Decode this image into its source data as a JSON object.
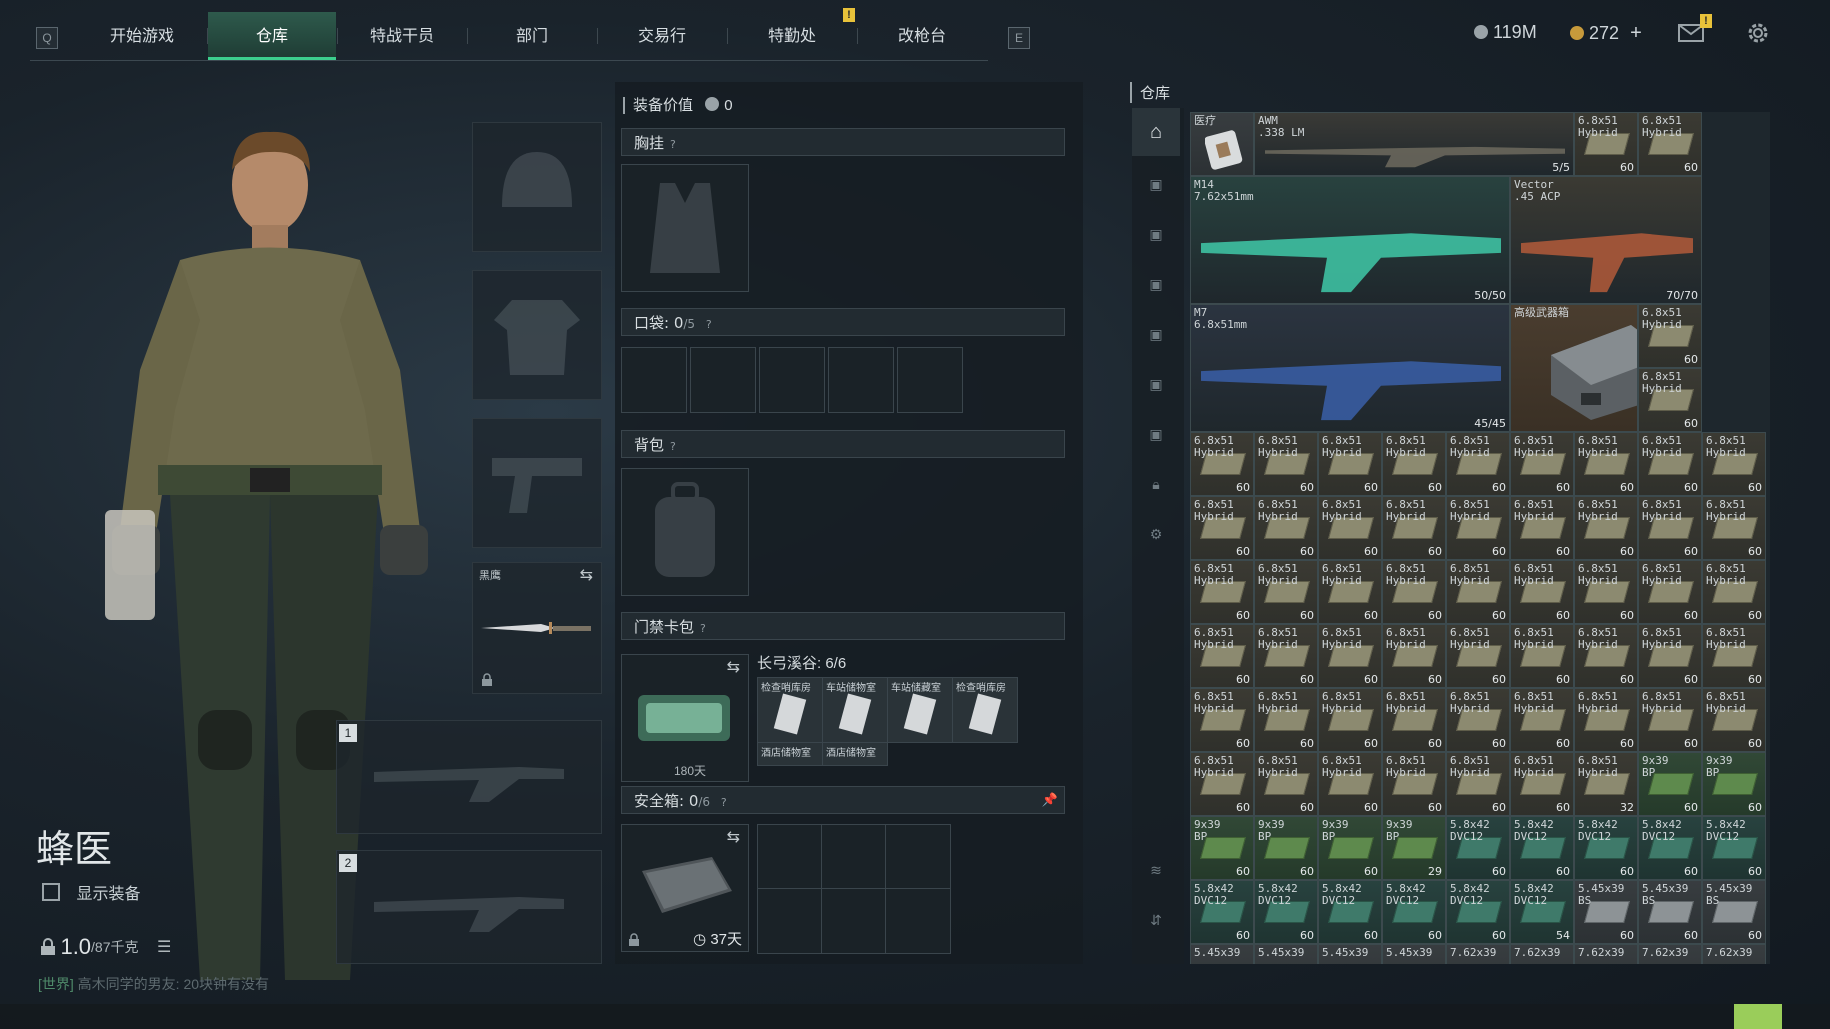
{
  "nav": {
    "left_key": "Q",
    "right_key": "E",
    "tabs": [
      {
        "label": "开始游戏",
        "active": false
      },
      {
        "label": "仓库",
        "active": true
      },
      {
        "label": "特战干员",
        "active": false
      },
      {
        "label": "部门",
        "active": false
      },
      {
        "label": "交易行",
        "active": false
      },
      {
        "label": "特勤处",
        "active": false
      },
      {
        "label": "改枪台",
        "active": false
      }
    ],
    "notif_mark": "!"
  },
  "currency": {
    "coins": "119M",
    "premium": "272",
    "premium_add": "+"
  },
  "character": {
    "name": "蜂医",
    "show_equipment_label": "显示装备",
    "weight": "1.0",
    "weight_max": "/87千克",
    "chat_channel": "[世界]",
    "chat_text": "高木同学的男友: 20块钟有没有",
    "knife_label": "黑鹰",
    "weapon_slot_1": "1",
    "weapon_slot_2": "2"
  },
  "equipment": {
    "value_label": "装备价值",
    "value": "0",
    "chest_rig": "胸挂",
    "pockets_label": "口袋:",
    "pockets_value": "0",
    "pockets_max": "/5",
    "backpack": "背包",
    "keycard_case": "门禁卡包",
    "keycard_map": "长弓溪谷: 6/6",
    "keycards": [
      "检查哨库房",
      "车站储物室",
      "车站储藏室",
      "检查哨库房",
      "酒店储物室",
      "酒店储物室"
    ],
    "keycard_days": "180天",
    "secure_label": "安全箱:",
    "secure_value": "0",
    "secure_max": "/6",
    "secure_days": "37天",
    "help": "?"
  },
  "warehouse": {
    "title": "仓库",
    "weapons": [
      {
        "name": "AWM\n.338 LM",
        "count": "5/5",
        "variant": "sniper"
      },
      {
        "name": "M14\n7.62x51mm",
        "count": "50/50",
        "variant": "teal"
      },
      {
        "name": "Vector\n.45 ACP",
        "count": "70/70",
        "variant": "flag"
      },
      {
        "name": "M7\n6.8x51mm",
        "count": "45/45",
        "variant": "blue"
      }
    ],
    "medkit_label": "医疗",
    "case_label": "高级武器箱",
    "ammo_rows": [
      [
        [
          "6.8x51\nHybrid",
          "60",
          "tan"
        ],
        [
          "6.8x51\nHybrid",
          "60",
          "tan"
        ]
      ],
      [
        [
          "6.8x51\nHybrid",
          "60",
          "tan"
        ],
        [
          "6.8x51\nHybrid",
          "60",
          "tan"
        ],
        [
          "6.8x51\nHybrid",
          "60",
          "tan"
        ],
        [
          "6.8x51\nHybrid",
          "60",
          "tan"
        ],
        [
          "6.8x51\nHybrid",
          "60",
          "tan"
        ],
        [
          "6.8x51\nHybrid",
          "60",
          "tan"
        ],
        [
          "6.8x51\nHybrid",
          "60",
          "tan"
        ],
        [
          "6.8x51\nHybrid",
          "60",
          "tan"
        ],
        [
          "6.8x51\nHybrid",
          "60",
          "tan"
        ]
      ],
      [
        [
          "6.8x51\nHybrid",
          "60",
          "tan"
        ],
        [
          "6.8x51\nHybrid",
          "60",
          "tan"
        ],
        [
          "6.8x51\nHybrid",
          "60",
          "tan"
        ],
        [
          "6.8x51\nHybrid",
          "60",
          "tan"
        ],
        [
          "6.8x51\nHybrid",
          "60",
          "tan"
        ],
        [
          "6.8x51\nHybrid",
          "60",
          "tan"
        ],
        [
          "6.8x51\nHybrid",
          "60",
          "tan"
        ],
        [
          "6.8x51\nHybrid",
          "60",
          "tan"
        ],
        [
          "6.8x51\nHybrid",
          "60",
          "tan"
        ]
      ],
      [
        [
          "6.8x51\nHybrid",
          "60",
          "tan"
        ],
        [
          "6.8x51\nHybrid",
          "60",
          "tan"
        ],
        [
          "6.8x51\nHybrid",
          "60",
          "tan"
        ],
        [
          "6.8x51\nHybrid",
          "60",
          "tan"
        ],
        [
          "6.8x51\nHybrid",
          "60",
          "tan"
        ],
        [
          "6.8x51\nHybrid",
          "60",
          "tan"
        ],
        [
          "6.8x51\nHybrid",
          "60",
          "tan"
        ],
        [
          "6.8x51\nHybrid",
          "60",
          "tan"
        ],
        [
          "6.8x51\nHybrid",
          "60",
          "tan"
        ]
      ],
      [
        [
          "6.8x51\nHybrid",
          "60",
          "tan"
        ],
        [
          "6.8x51\nHybrid",
          "60",
          "tan"
        ],
        [
          "6.8x51\nHybrid",
          "60",
          "tan"
        ],
        [
          "6.8x51\nHybrid",
          "60",
          "tan"
        ],
        [
          "6.8x51\nHybrid",
          "60",
          "tan"
        ],
        [
          "6.8x51\nHybrid",
          "60",
          "tan"
        ],
        [
          "6.8x51\nHybrid",
          "60",
          "tan"
        ],
        [
          "6.8x51\nHybrid",
          "60",
          "tan"
        ],
        [
          "6.8x51\nHybrid",
          "60",
          "tan"
        ]
      ],
      [
        [
          "6.8x51\nHybrid",
          "60",
          "tan"
        ],
        [
          "6.8x51\nHybrid",
          "60",
          "tan"
        ],
        [
          "6.8x51\nHybrid",
          "60",
          "tan"
        ],
        [
          "6.8x51\nHybrid",
          "60",
          "tan"
        ],
        [
          "6.8x51\nHybrid",
          "60",
          "tan"
        ],
        [
          "6.8x51\nHybrid",
          "60",
          "tan"
        ],
        [
          "6.8x51\nHybrid",
          "60",
          "tan"
        ],
        [
          "6.8x51\nHybrid",
          "60",
          "tan"
        ],
        [
          "6.8x51\nHybrid",
          "60",
          "tan"
        ]
      ],
      [
        [
          "6.8x51\nHybrid",
          "60",
          "tan"
        ],
        [
          "6.8x51\nHybrid",
          "60",
          "tan"
        ],
        [
          "6.8x51\nHybrid",
          "60",
          "tan"
        ],
        [
          "6.8x51\nHybrid",
          "60",
          "tan"
        ],
        [
          "6.8x51\nHybrid",
          "60",
          "tan"
        ],
        [
          "6.8x51\nHybrid",
          "60",
          "tan"
        ],
        [
          "6.8x51\nHybrid",
          "32",
          "tan"
        ],
        [
          "9x39\nBP",
          "60",
          "green"
        ],
        [
          "9x39\nBP",
          "60",
          "green"
        ]
      ],
      [
        [
          "9x39\nBP",
          "60",
          "green"
        ],
        [
          "9x39\nBP",
          "60",
          "green"
        ],
        [
          "9x39\nBP",
          "60",
          "green"
        ],
        [
          "9x39\nBP",
          "29",
          "green"
        ],
        [
          "5.8x42\nDVC12",
          "60",
          "teal"
        ],
        [
          "5.8x42\nDVC12",
          "60",
          "teal"
        ],
        [
          "5.8x42\nDVC12",
          "60",
          "teal"
        ],
        [
          "5.8x42\nDVC12",
          "60",
          "teal"
        ],
        [
          "5.8x42\nDVC12",
          "60",
          "teal"
        ]
      ],
      [
        [
          "5.8x42\nDVC12",
          "60",
          "teal"
        ],
        [
          "5.8x42\nDVC12",
          "60",
          "teal"
        ],
        [
          "5.8x42\nDVC12",
          "60",
          "teal"
        ],
        [
          "5.8x42\nDVC12",
          "60",
          "teal"
        ],
        [
          "5.8x42\nDVC12",
          "60",
          "teal"
        ],
        [
          "5.8x42\nDVC12",
          "54",
          "teal"
        ],
        [
          "5.45x39\nBS",
          "60",
          "grey"
        ],
        [
          "5.45x39\nBS",
          "60",
          "grey"
        ],
        [
          "5.45x39\nBS",
          "60",
          "grey"
        ]
      ],
      [
        [
          "5.45x39",
          "",
          ""
        ],
        [
          "5.45x39",
          "",
          ""
        ],
        [
          "5.45x39",
          "",
          ""
        ],
        [
          "5.45x39",
          "",
          ""
        ],
        [
          "7.62x39",
          "",
          ""
        ],
        [
          "7.62x39",
          "",
          ""
        ],
        [
          "7.62x39",
          "",
          ""
        ],
        [
          "7.62x39",
          "",
          ""
        ],
        [
          "7.62x39",
          "",
          ""
        ]
      ]
    ]
  }
}
